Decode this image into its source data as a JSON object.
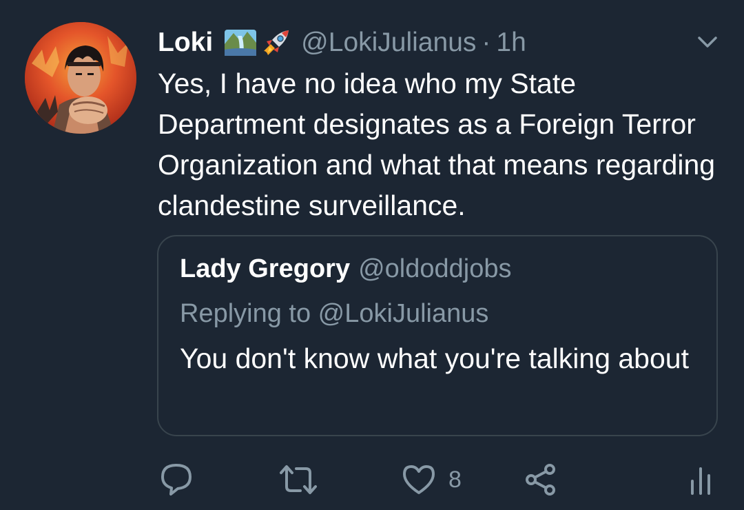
{
  "tweet": {
    "author_name": "Loki",
    "author_handle": "@LokiJulianus",
    "separator": "·",
    "time": "1h",
    "name_emojis": [
      "waterfall-emoji",
      "rocket-emoji"
    ],
    "text": "Yes, I have no idea who my State Department designates as a Foreign Terror Organization and what that means regarding clandestine surveillance."
  },
  "quote": {
    "author_name": "Lady Gregory",
    "author_handle": "@oldoddjobs",
    "replying_to": "Replying to @LokiJulianus",
    "text": "You don't know what you're talking about"
  },
  "actions": {
    "like_count": "8",
    "icons": [
      "reply-icon",
      "retweet-icon",
      "like-icon",
      "share-icon",
      "analytics-icon"
    ]
  },
  "colors": {
    "background": "#1c2633",
    "primary_text": "#ffffff",
    "secondary_text": "#8899a6",
    "border": "#38444d"
  }
}
